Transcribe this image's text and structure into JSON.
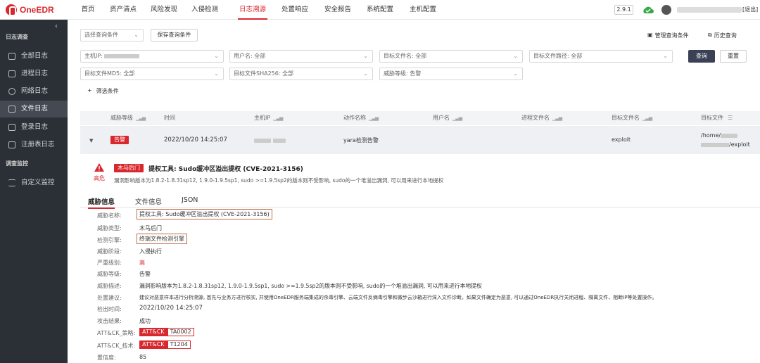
{
  "app": {
    "logo": "OneEDR",
    "version": "2.9.1",
    "logout": "[退出]"
  },
  "nav": [
    "首页",
    "资产清点",
    "风险发现",
    "入侵检测",
    "日志溯源",
    "处置响应",
    "安全报告",
    "系统配置",
    "主机配置"
  ],
  "nav_active": "日志溯源",
  "sidebar": {
    "group1": "日志调查",
    "items": [
      "全部日志",
      "进程日志",
      "网络日志",
      "文件日志",
      "登录日志",
      "注册表日志"
    ],
    "active": "文件日志",
    "group2": "调查监控",
    "items2": [
      "自定义监控"
    ]
  },
  "toolbar": {
    "select_placeholder": "选择查询条件",
    "save_button": "保存查询条件",
    "manage_link": "管理查询条件",
    "history_link": "历史查询"
  },
  "filters": {
    "host_ip": "主机IP:",
    "user_name": "用户名: 全部",
    "target_file_name": "目标文件名: 全部",
    "target_file_path": "目标文件路径: 全部",
    "md5": "目标文件MD5: 全部",
    "sha256": "目标文件SHA256: 全部",
    "threat_level": "威胁等级: 告警",
    "query_button": "查询",
    "reset_button": "重置",
    "add_filter": "筛选条件",
    "add_plus": "+"
  },
  "table": {
    "headers": [
      "威胁等级",
      "时间",
      "主机IP",
      "动作名称",
      "用户名",
      "进程文件名",
      "目标文件名",
      "目标文件"
    ],
    "row": {
      "level": "告警",
      "time": "2022/10/20 14:25:07",
      "action": "yara检测告警",
      "target_name": "exploit",
      "target_path_1": "/home/",
      "target_path_2": "/exploit"
    }
  },
  "alert": {
    "severity_label": "高危",
    "tag": "木马后门",
    "title": "提权工具: Sudo缓冲区溢出提权 (CVE-2021-3156)",
    "desc": "漏洞影响版本为1.8.2-1.8.31sp12, 1.9.0-1.9.5sp1, sudo >=1.9.5sp2的版本则不受影响, sudo的一个堆溢出漏洞, 可以用来进行本地提权"
  },
  "tabs": [
    "威胁信息",
    "文件信息",
    "JSON"
  ],
  "tab_active": "威胁信息",
  "details": [
    {
      "label": "威胁名称:",
      "value": "提权工具: Sudo缓冲区溢出提权 (CVE-2021-3156)"
    },
    {
      "label": "威胁类型:",
      "value": "木马后门"
    },
    {
      "label": "检测引擎:",
      "value": "终端文件检测引擎"
    },
    {
      "label": "威胁阶段:",
      "value": "入侵执行"
    },
    {
      "label": "严重级别:",
      "value": "高"
    },
    {
      "label": "威胁等级:",
      "value": "告警"
    },
    {
      "label": "威胁描述:",
      "value": "漏洞影响版本为1.8.2-1.8.31sp12, 1.9.0-1.9.5sp1, sudo >=1.9.5sp2的版本则不受影响, sudo的一个堆溢出漏洞, 可以用来进行本地提权"
    },
    {
      "label": "处置建议:",
      "value": "建议对恶意样本进行分析溯源, 首先与业务方进行核实, 并使用OneEDR服务端集成的杀毒引擎、云端文件反病毒引擎和微步云沙箱进行深入文件诊断。如果文件确定为恶意, 可以通过OneEDR执行关闭进程、隔离文件、阻断IP等处置操作。"
    },
    {
      "label": "检出时间:",
      "value": "2022/10/20 14:25:07"
    },
    {
      "label": "攻击结果:",
      "value": "成功"
    },
    {
      "label": "ATT&CK_策略:",
      "tag": "ATT&CK",
      "value": "TA0002"
    },
    {
      "label": "ATT&CK_技术:",
      "tag": "ATT&CK",
      "value": "T1204"
    },
    {
      "label": "置信度:",
      "value": "85"
    }
  ],
  "colors": {
    "brand": "#d9272e",
    "sidebar": "#2b2f36",
    "primary_button": "#3a4155",
    "highlight_box": "#c0704a"
  }
}
